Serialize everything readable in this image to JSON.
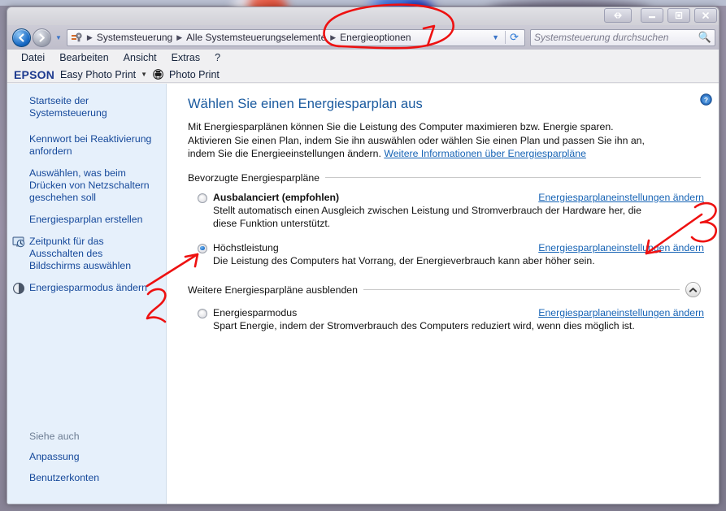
{
  "window": {
    "controls": {
      "resize": "resize-arrows",
      "minimize": "Minimieren",
      "maximize": "Maximieren",
      "close": "Schließen"
    }
  },
  "address_bar": {
    "back_label": "Zurück",
    "forward_label": "Vorwärts",
    "recent_dropdown": "Zuletzt besuchte Seiten",
    "breadcrumbs": [
      "Systemsteuerung",
      "Alle Systemsteuerungselemente",
      "Energieoptionen"
    ],
    "dropdown_label": "Vorherige Adressen",
    "refresh_label": "Aktualisieren",
    "search_placeholder": "Systemsteuerung durchsuchen"
  },
  "menu_bar": {
    "items": [
      "Datei",
      "Bearbeiten",
      "Ansicht",
      "Extras",
      "?"
    ]
  },
  "epson_toolbar": {
    "logo": "EPSON",
    "easy_photo_print": "Easy Photo Print",
    "dropdown_caret": "▼",
    "photo_print": "Photo Print"
  },
  "sidebar": {
    "items": [
      {
        "label": "Startseite der Systemsteuerung",
        "icon": null
      },
      {
        "label": "Kennwort bei Reaktivierung anfordern",
        "icon": null
      },
      {
        "label": "Auswählen, was beim Drücken von Netzschaltern geschehen soll",
        "icon": null
      },
      {
        "label": "Energiesparplan erstellen",
        "icon": null
      },
      {
        "label": "Zeitpunkt für das Ausschalten des Bildschirms auswählen",
        "icon": "monitor-clock-icon"
      },
      {
        "label": "Energiesparmodus ändern",
        "icon": "brightness-icon"
      }
    ],
    "see_also": {
      "heading": "Siehe auch",
      "links": [
        "Anpassung",
        "Benutzerkonten"
      ]
    }
  },
  "main": {
    "help_icon": "help-icon",
    "title": "Wählen Sie einen Energiesparplan aus",
    "intro_text": "Mit Energiesparplänen können Sie die Leistung des Computer maximieren bzw. Energie sparen. Aktivieren Sie einen Plan, indem Sie ihn auswählen oder wählen Sie einen Plan und passen Sie ihn an, indem Sie die Energieeinstellungen ändern.",
    "intro_link": "Weitere Informationen über Energiesparpläne",
    "preferred_group_label": "Bevorzugte Energiesparpläne",
    "more_group_label": "Weitere Energiesparpläne ausblenden",
    "collapse_button": "chevron-up-icon",
    "plans": [
      {
        "name": "Ausbalanciert (empfohlen)",
        "bold": true,
        "selected": false,
        "description": "Stellt automatisch einen Ausgleich zwischen Leistung und Stromverbrauch der Hardware her, die diese Funktion unterstützt.",
        "settings_link": "Energiesparplaneinstellungen ändern"
      },
      {
        "name": "Höchstleistung",
        "bold": false,
        "selected": true,
        "description": "Die Leistung des Computers hat Vorrang, der Energieverbrauch kann aber höher sein.",
        "settings_link": "Energiesparplaneinstellungen ändern"
      }
    ],
    "more_plans": [
      {
        "name": "Energiesparmodus",
        "bold": false,
        "selected": false,
        "description": "Spart Energie, indem der Stromverbrauch des Computers reduziert wird, wenn dies möglich ist.",
        "settings_link": "Energiesparplaneinstellungen ändern"
      }
    ]
  },
  "annotations": {
    "color": "#ee1111",
    "marks": [
      {
        "label": "1",
        "target": "Energieoptionen breadcrumb (red ellipse)"
      },
      {
        "label": "2",
        "target": "Höchstleistung radio button (red arrow)"
      },
      {
        "label": "3",
        "target": "Energiesparplaneinstellungen ändern link (red arrow)"
      }
    ]
  },
  "colors": {
    "accent_link": "#1663b5",
    "title_blue": "#19599e",
    "sidebar_bg": "#e6f0fb",
    "annotation_red": "#ee1111"
  }
}
